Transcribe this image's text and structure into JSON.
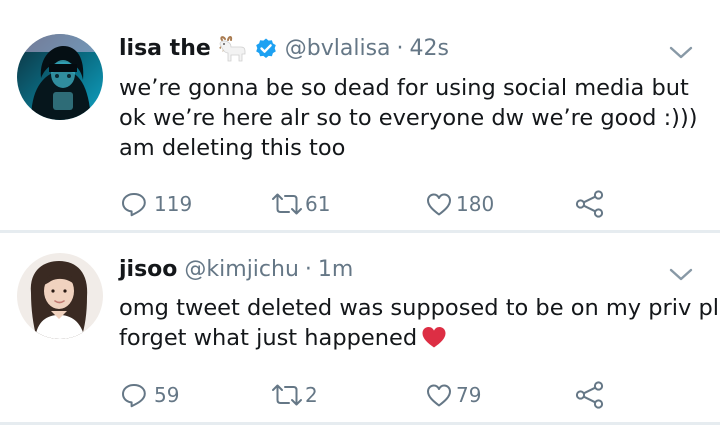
{
  "tweets": [
    {
      "display_name": "lisa the",
      "name_emoji": "goat-emoji",
      "verified": true,
      "handle": "@bvlalisa",
      "separator": "·",
      "time": "42s",
      "lines": [
        "we’re gonna be so dead for using social media but",
        "ok we’re here alr so to everyone dw we’re good :)))",
        "am deleting this too"
      ],
      "replies": "119",
      "retweets": "61",
      "likes": "180"
    },
    {
      "display_name": "jisoo",
      "handle": "@kimjichu",
      "separator": "·",
      "time": "1m",
      "lines": [
        "omg tweet deleted was supposed to be on my priv pls",
        "forget what just happened"
      ],
      "trailing_emoji": "red-heart-emoji",
      "replies": "59",
      "retweets": "2",
      "likes": "79"
    }
  ],
  "colors": {
    "text": "#14171a",
    "secondary": "#657786",
    "verified": "#1da1f2",
    "divider": "#e6ecf0",
    "heart": "#e0245e"
  }
}
